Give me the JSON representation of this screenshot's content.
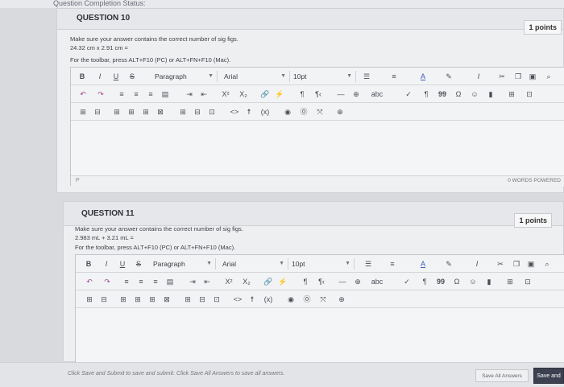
{
  "status": {
    "label": "Question Completion Status:"
  },
  "questions": [
    {
      "title": "QUESTION 10",
      "points": "1 points",
      "instruction": "Make sure your answer contains the correct number of sig figs.",
      "expression": "24.32 cm x 2.91 cm =",
      "toolbar_hint": "For the toolbar, press ALT+F10 (PC) or ALT+FN+F10 (Mac).",
      "paragraph_select": "Paragraph",
      "font_select": "Arial",
      "size_select": "10pt",
      "path_label": "P",
      "word_count": "0 WORDS",
      "powered": "POWERED"
    },
    {
      "title": "QUESTION 11",
      "points": "1 points",
      "instruction": "Make sure your answer contains the correct number of sig figs.",
      "expression": "2.983 mL + 3.21 mL =",
      "toolbar_hint": "For the toolbar, press ALT+F10 (PC) or ALT+FN+F10 (Mac).",
      "paragraph_select": "Paragraph",
      "font_select": "Arial",
      "size_select": "10pt"
    }
  ],
  "toolbar": {
    "bold": "B",
    "italic": "I",
    "underline": "U",
    "strike": "S",
    "superscript": "X²",
    "subscript": "X₂",
    "code": "<>",
    "paragraph_mark": "¶",
    "quote": "99",
    "omega": "Ω",
    "italic_clear": "I",
    "text_color": "A",
    "highlight": "A"
  },
  "footer": {
    "hint": "Click Save and Submit to save and submit. Click Save All Answers to save all answers.",
    "save_all": "Save All Answers",
    "save_submit": "Save and"
  }
}
